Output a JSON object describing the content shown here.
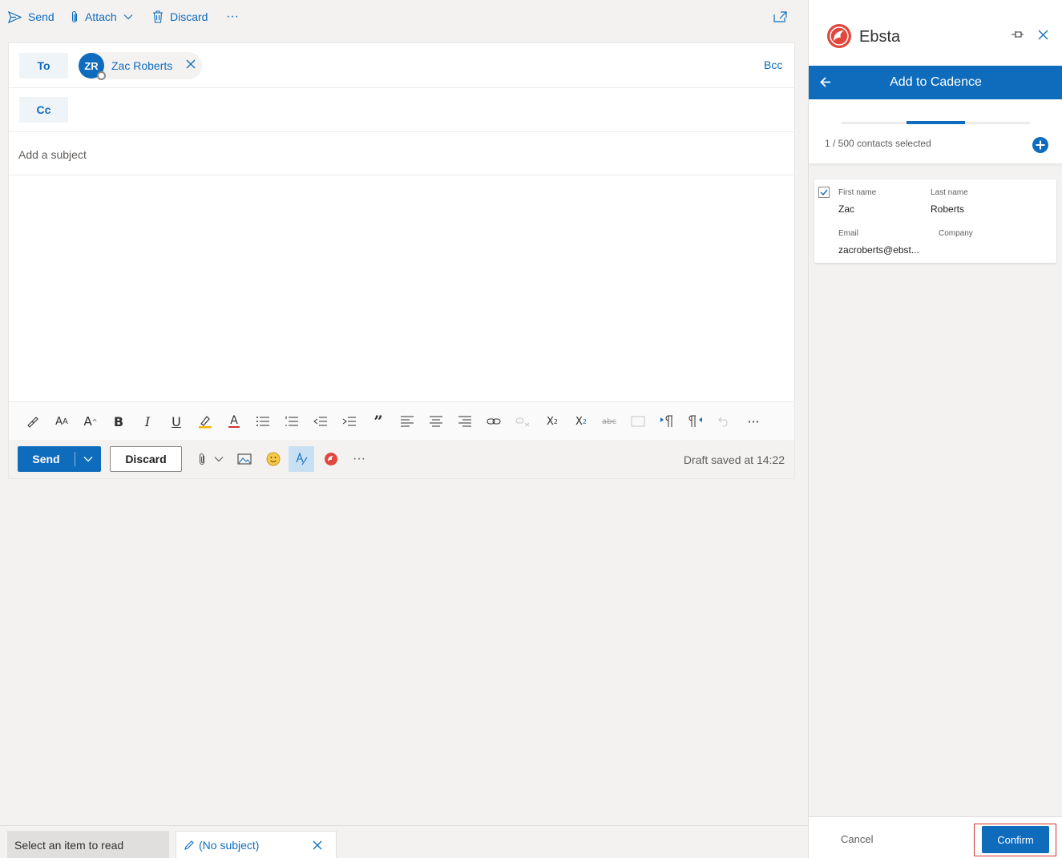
{
  "toolbar": {
    "send_label": "Send",
    "attach_label": "Attach",
    "discard_label": "Discard",
    "more_label": "···"
  },
  "compose": {
    "to_label": "To",
    "cc_label": "Cc",
    "bcc_label": "Bcc",
    "recipient": {
      "initials": "ZR",
      "name": "Zac Roberts"
    },
    "subject_placeholder": "Add a subject",
    "send_label": "Send",
    "discard_label": "Discard",
    "draft_status": "Draft saved at 14:22"
  },
  "format_icons": [
    "format-painter-icon",
    "font-size-icon",
    "grow-font-icon",
    "bold-icon",
    "italic-icon",
    "underline-icon",
    "highlight-icon",
    "font-color-icon",
    "bullets-icon",
    "numbering-icon",
    "decrease-indent-icon",
    "increase-indent-icon",
    "quote-icon",
    "align-left-icon",
    "align-center-icon",
    "align-right-icon",
    "link-icon",
    "unlink-icon",
    "superscript-icon",
    "subscript-icon",
    "strikethrough-icon",
    "insert-picture-icon",
    "ltr-icon",
    "rtl-icon",
    "undo-icon",
    "more-icon"
  ],
  "bottom_tabs": {
    "read_label": "Select an item to read",
    "draft_label": "(No subject)"
  },
  "panel": {
    "brand": "Ebsta",
    "title": "Add to Cadence",
    "selection_count": "1 / 500 contacts selected",
    "contact": {
      "first_name_label": "First name",
      "first_name": "Zac",
      "last_name_label": "Last name",
      "last_name": "Roberts",
      "email_label": "Email",
      "email": "zacroberts@ebst...",
      "company_label": "Company",
      "company": ""
    },
    "cancel_label": "Cancel",
    "confirm_label": "Confirm"
  },
  "colors": {
    "accent": "#0f6cbd",
    "brand": "#e0483e",
    "highlight_outline": "#d13438"
  }
}
